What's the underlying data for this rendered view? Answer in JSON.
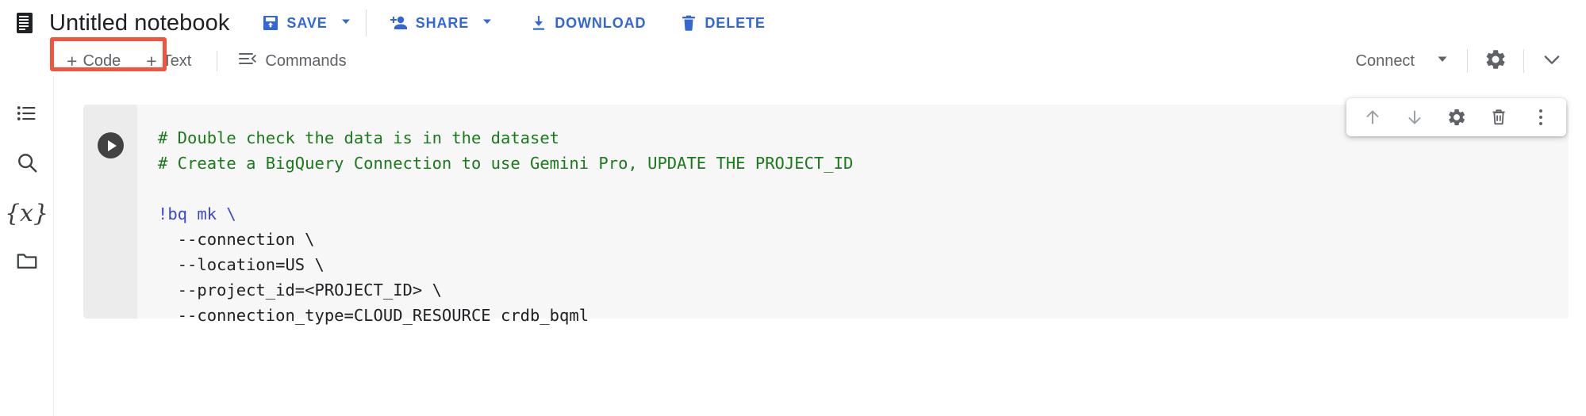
{
  "topbar": {
    "notebook_icon": "notebook-icon",
    "title": "Untitled notebook",
    "save_label": "SAVE",
    "save_icon": "save-icon",
    "save_caret_icon": "caret-down-icon",
    "share_label": "SHARE",
    "share_icon": "person-add-icon",
    "share_caret_icon": "caret-down-icon",
    "download_label": "DOWNLOAD",
    "download_icon": "download-icon",
    "delete_label": "DELETE",
    "delete_icon": "trash-icon",
    "accent_color": "#3367d6"
  },
  "toolbar2": {
    "add_code_label": "Code",
    "add_code_plus": "+",
    "add_text_label": "Text",
    "add_text_plus": "+",
    "commands_label": "Commands",
    "commands_icon": "commands-icon",
    "connect_label": "Connect",
    "connect_caret_icon": "caret-down-icon",
    "settings_icon": "gear-icon",
    "expand_icon": "chevron-down-icon",
    "highlight_color": "#f4533c",
    "highlighted_target": "add-code-button"
  },
  "rail": {
    "items": [
      {
        "name": "toc-icon",
        "label": "Table of contents"
      },
      {
        "name": "search-icon",
        "label": "Find and replace"
      },
      {
        "name": "variables-icon",
        "label": "{x}"
      },
      {
        "name": "files-icon",
        "label": "Files"
      }
    ]
  },
  "cell": {
    "run_icon": "run-icon",
    "code_lines": [
      {
        "text": "# Double check the data is in the dataset",
        "style": "comment"
      },
      {
        "text": "# Create a BigQuery Connection to use Gemini Pro, UPDATE THE PROJECT_ID",
        "style": "comment"
      },
      {
        "text": "",
        "style": "plain"
      },
      {
        "text": "!bq mk \\",
        "style": "shell"
      },
      {
        "text": "  --connection \\",
        "style": "plain"
      },
      {
        "text": "  --location=US \\",
        "style": "plain"
      },
      {
        "text": "  --project_id=<PROJECT_ID> \\",
        "style": "plain"
      },
      {
        "text": "  --connection_type=CLOUD_RESOURCE crdb_bqml",
        "style": "plain"
      }
    ],
    "comment_color": "#1a7a1a",
    "toolbar": [
      {
        "name": "move-cell-up-icon"
      },
      {
        "name": "move-cell-down-icon"
      },
      {
        "name": "cell-settings-icon"
      },
      {
        "name": "delete-cell-icon"
      },
      {
        "name": "more-options-icon"
      }
    ]
  }
}
